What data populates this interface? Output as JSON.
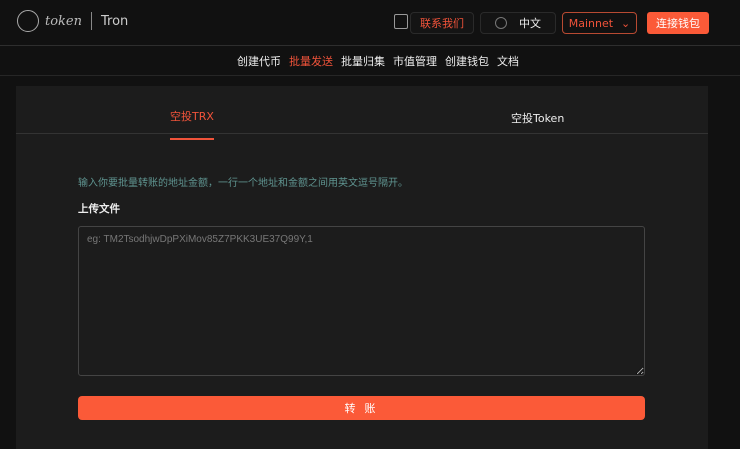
{
  "header": {
    "logo_text": "token",
    "network_label": "Tron",
    "contact": "联系我们",
    "language": "中文",
    "network": "Mainnet",
    "connect": "连接钱包"
  },
  "nav": [
    "创建代币",
    "批量发送",
    "批量归集",
    "市值管理",
    "创建钱包",
    "文档"
  ],
  "tabs": [
    "空投TRX",
    "空投Token"
  ],
  "form": {
    "hint": "输入你要批量转账的地址金额，一行一个地址和金额之间用英文逗号隔开。",
    "upload_label": "上传文件",
    "placeholder": "eg: TM2TsodhjwDpPXiMov85Z7PKK3UE37Q99Y,1",
    "submit": "转 账"
  },
  "colors": {
    "accent": "#fb5a38",
    "hint": "#5f9490"
  }
}
